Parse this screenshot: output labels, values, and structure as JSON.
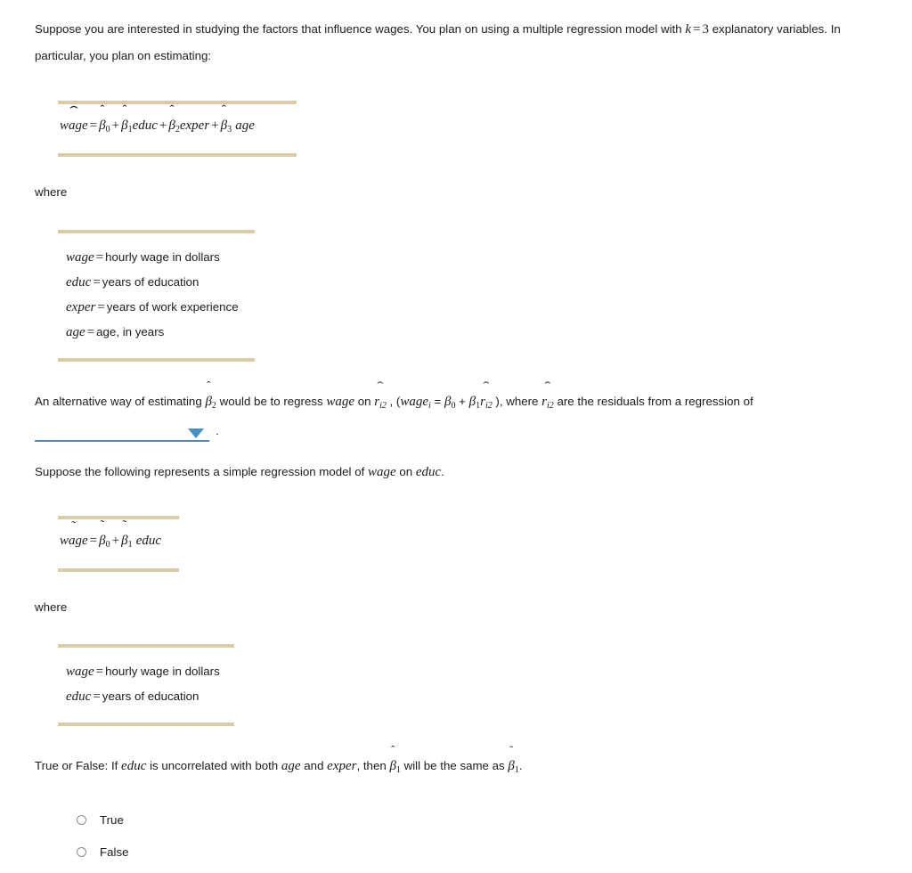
{
  "question": {
    "intro": {
      "part1": "Suppose you are interested in studying the factors that influence wages. You plan on using a multiple regression model with ",
      "k_symbol": "k",
      "k_equals": "=",
      "k_value": "3",
      "part2": " explanatory variables. In particular, you plan on estimating:"
    },
    "equation_1": {
      "lhs": "wage",
      "eq": "=",
      "terms": [
        {
          "coef": "β",
          "sub": "0",
          "var": "",
          "op": ""
        },
        {
          "coef": "β",
          "sub": "1",
          "var": "educ",
          "op": "+"
        },
        {
          "coef": "β",
          "sub": "2",
          "var": "exper",
          "op": "+"
        },
        {
          "coef": "β",
          "sub": "3",
          "var": "age",
          "op": "+"
        }
      ]
    },
    "where_label_1": "where",
    "definitions_1": [
      {
        "term": "wage",
        "eq": "=",
        "meaning": "hourly wage in dollars"
      },
      {
        "term": "educ",
        "eq": "=",
        "meaning": "years of education"
      },
      {
        "term": "exper",
        "eq": "=",
        "meaning": "years of work experience"
      },
      {
        "term": "age",
        "eq": "=",
        "meaning": "age, in years"
      }
    ],
    "alternative": {
      "seg1": "An alternative way of estimating ",
      "beta2": "β",
      "beta2_sub": "2",
      "seg2": " would be to regress ",
      "wage": "wage",
      "seg3": " on ",
      "r1": "r",
      "r1_sub": "i2",
      "seg4": " , (",
      "wage_i": "wage",
      "wage_i_sub": "i",
      "seg5": " = ",
      "b0": "β",
      "b0_sub": "0",
      "plus": " + ",
      "b1": "β",
      "b1_sub": "1",
      "r2": "r",
      "r2_sub": "i2",
      "seg6": " ), where ",
      "r3": "r",
      "r3_sub": "i2",
      "seg7": " are the residuals from a regression of"
    },
    "dropdown": {
      "value": "",
      "placeholder": "",
      "trailing_period": "."
    },
    "simple_model_intro": {
      "seg1": "Suppose the following represents a simple regression model of ",
      "var1": "wage",
      "seg2": " on ",
      "var2": "educ",
      "seg3": "."
    },
    "equation_2": {
      "lhs": "wage",
      "eq": "=",
      "terms": [
        {
          "coef": "β",
          "sub": "0",
          "var": "",
          "op": ""
        },
        {
          "coef": "β",
          "sub": "1",
          "var": "educ",
          "op": "+"
        }
      ]
    },
    "where_label_2": "where",
    "definitions_2": [
      {
        "term": "wage",
        "eq": "=",
        "meaning": "hourly wage in dollars"
      },
      {
        "term": "educ",
        "eq": "=",
        "meaning": "years of education"
      }
    ],
    "true_false": {
      "seg1": "True or False: If ",
      "var1": "educ",
      "seg2": " is uncorrelated with both ",
      "var2": "age",
      "seg3": " and ",
      "var3": "exper",
      "seg4": ", then ",
      "beta_hat": "β",
      "beta_hat_sub": "1",
      "seg5": " will be the same as ",
      "beta_tilde": "β",
      "beta_tilde_sub": "1",
      "seg6": "."
    },
    "options": [
      {
        "label": "True",
        "selected": false
      },
      {
        "label": "False",
        "selected": false
      }
    ]
  },
  "accents": {
    "hat": "ˆ",
    "widehat": "ˆ",
    "tilde": "˜"
  },
  "colors": {
    "rule": "#d9cba3",
    "dropdown": "#4a8fc4",
    "text": "#1b1b1b"
  }
}
